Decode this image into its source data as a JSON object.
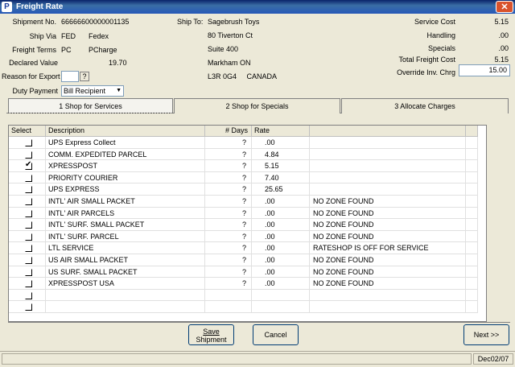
{
  "window": {
    "title": "Freight Rate",
    "close_glyph": "✕",
    "app_icon_glyph": "P"
  },
  "shipment": {
    "shipment_no_label": "Shipment No.",
    "shipment_no": "66666600000001135",
    "ship_via_label": "Ship Via",
    "ship_via_code": "FED",
    "ship_via_name": "Fedex",
    "freight_terms_label": "Freight Terms",
    "freight_terms_code": "PC",
    "freight_terms_name": "PCharge",
    "declared_value_label": "Declared Value",
    "declared_value": "19.70",
    "reason_for_export_label": "Reason for Export",
    "reason_for_export_value": "",
    "reason_btn": "?",
    "duty_payment_label": "Duty Payment",
    "duty_payment_value": "Bill Recipient"
  },
  "ship_to": {
    "label": "Ship To:",
    "lines": [
      "Sagebrush Toys",
      "80 Tiverton Ct",
      "Suite 400",
      "Markham  ON",
      "L3R 0G4     CANADA"
    ]
  },
  "costs": {
    "service_cost_label": "Service Cost",
    "service_cost": "5.15",
    "handling_label": "Handling",
    "handling": ".00",
    "specials_label": "Specials",
    "specials": ".00",
    "total_freight_label": "Total Freight Cost",
    "total_freight": "5.15",
    "override_label": "Override Inv. Chrg",
    "override_value": "15.00"
  },
  "tabs": [
    {
      "label": "1 Shop for Services",
      "active": true
    },
    {
      "label": "2 Shop for Specials",
      "active": false
    },
    {
      "label": "3 Allocate Charges",
      "active": false
    }
  ],
  "grid": {
    "columns": [
      "Select",
      "Description",
      "# Days",
      "Rate",
      ""
    ],
    "rows": [
      {
        "checked": false,
        "description": "UPS Express Collect",
        "days": "?",
        "rate": ".00",
        "note": ""
      },
      {
        "checked": false,
        "description": "COMM. EXPEDITED PARCEL",
        "days": "?",
        "rate": "4.84",
        "note": ""
      },
      {
        "checked": true,
        "description": "XPRESSPOST",
        "days": "?",
        "rate": "5.15",
        "note": ""
      },
      {
        "checked": false,
        "description": "PRIORITY COURIER",
        "days": "?",
        "rate": "7.40",
        "note": ""
      },
      {
        "checked": false,
        "description": "UPS EXPRESS",
        "days": "?",
        "rate": "25.65",
        "note": ""
      },
      {
        "checked": false,
        "description": "INTL' AIR SMALL PACKET",
        "days": "?",
        "rate": ".00",
        "note": "NO ZONE FOUND"
      },
      {
        "checked": false,
        "description": "INTL' AIR PARCELS",
        "days": "?",
        "rate": ".00",
        "note": "NO ZONE FOUND"
      },
      {
        "checked": false,
        "description": "INTL' SURF. SMALL PACKET",
        "days": "?",
        "rate": ".00",
        "note": "NO ZONE FOUND"
      },
      {
        "checked": false,
        "description": "INTL' SURF. PARCEL",
        "days": "?",
        "rate": ".00",
        "note": "NO ZONE FOUND"
      },
      {
        "checked": false,
        "description": "LTL SERVICE",
        "days": "?",
        "rate": ".00",
        "note": "RATESHOP IS OFF FOR SERVICE"
      },
      {
        "checked": false,
        "description": "US AIR SMALL PACKET",
        "days": "?",
        "rate": ".00",
        "note": "NO ZONE FOUND"
      },
      {
        "checked": false,
        "description": "US SURF. SMALL PACKET",
        "days": "?",
        "rate": ".00",
        "note": "NO ZONE FOUND"
      },
      {
        "checked": false,
        "description": "XPRESSPOST USA",
        "days": "?",
        "rate": ".00",
        "note": "NO ZONE FOUND"
      },
      {
        "checked": false,
        "description": "",
        "days": "",
        "rate": "",
        "note": ""
      },
      {
        "checked": false,
        "description": "",
        "days": "",
        "rate": "",
        "note": ""
      }
    ]
  },
  "buttons": {
    "save_line1": "Save",
    "save_line2": "Shipment",
    "cancel": "Cancel",
    "next": "Next >>"
  },
  "status": {
    "date": "Dec02/07"
  },
  "check_glyph": "✔"
}
